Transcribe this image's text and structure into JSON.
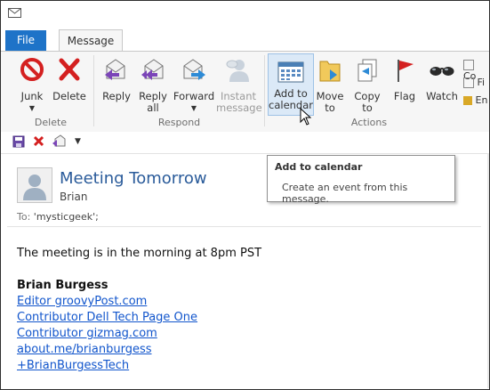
{
  "tabs": {
    "file": "File",
    "message": "Message"
  },
  "ribbon": {
    "delete_group": {
      "label": "Delete",
      "junk": "Junk",
      "delete": "Delete"
    },
    "respond_group": {
      "label": "Respond",
      "reply": "Reply",
      "reply_all_1": "Reply",
      "reply_all_2": "all",
      "forward": "Forward",
      "instant_1": "Instant",
      "instant_2": "message"
    },
    "actions_group": {
      "label": "Actions",
      "add_cal_1": "Add to",
      "add_cal_2": "calendar",
      "move_1": "Move",
      "move_2": "to",
      "copy_1": "Copy",
      "copy_2": "to",
      "flag": "Flag",
      "watch": "Watch",
      "cut_1": "Co",
      "cut_2": "Fi",
      "cut_3": "En"
    }
  },
  "tooltip": {
    "title": "Add to calendar",
    "description": "Create an event from this message."
  },
  "message": {
    "subject": "Meeting Tomorrow",
    "sender": "Brian",
    "to_label": "To:",
    "to_value": "'mysticgeek';",
    "body_text": "The meeting is in the morning at 8pm PST",
    "signature_name": "Brian Burgess",
    "links": [
      "Editor groovyPost.com",
      "Contributor Dell Tech Page One",
      "Contributor gizmag.com",
      "about.me/brianburgess",
      "+BrianBurgessTech"
    ]
  },
  "colors": {
    "accent": "#1e73c8",
    "link": "#1155cc",
    "subject": "#2a5b9a"
  }
}
